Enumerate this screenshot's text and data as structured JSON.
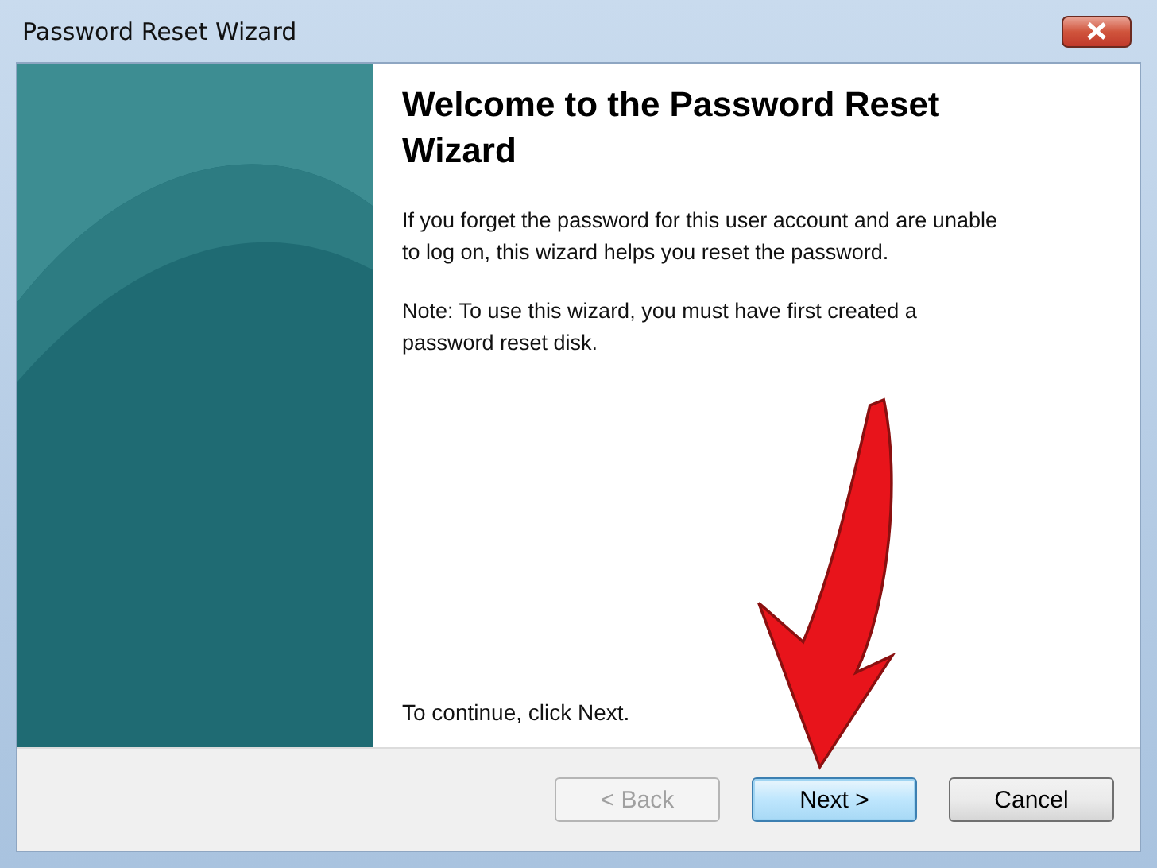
{
  "window": {
    "title": "Password Reset Wizard"
  },
  "heading": "Welcome to the Password Reset Wizard",
  "paragraphs": [
    "If you forget the password for this user account and are unable to log on, this wizard helps you reset the password.",
    "Note: To use this wizard, you must have first created a password reset disk."
  ],
  "footer_text": "To continue, click Next.",
  "buttons": [
    {
      "label": "< Back",
      "disabled": true,
      "default": false
    },
    {
      "label": "Next >",
      "disabled": false,
      "default": true
    },
    {
      "label": "Cancel",
      "disabled": false,
      "default": false
    }
  ]
}
